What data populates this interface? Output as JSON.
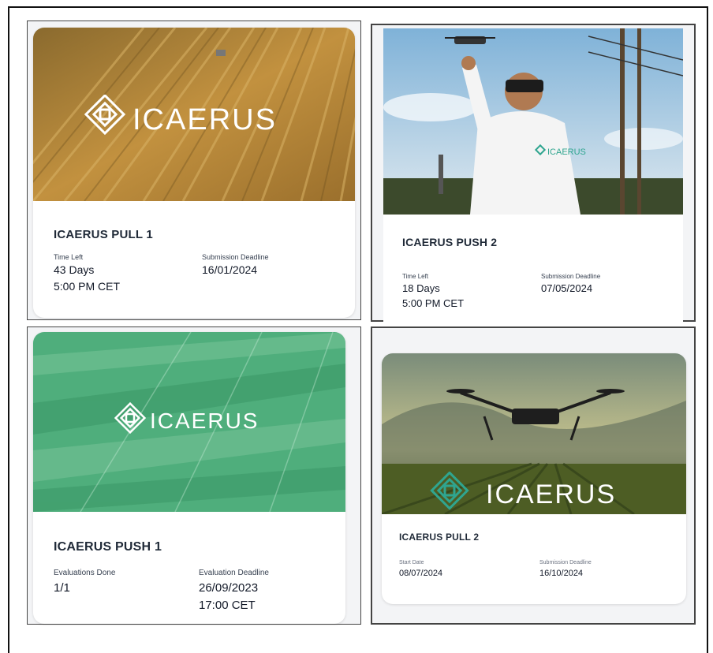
{
  "cards": [
    {
      "title": "ICAERUS PULL 1",
      "left_label": "Time Left",
      "left_value": "43 Days",
      "left_value2": "5:00 PM CET",
      "right_label": "Submission Deadline",
      "right_value": "16/01/2024",
      "logo_text": "ICAERUS"
    },
    {
      "title": "ICAERUS PUSH 2",
      "left_label": "Time Left",
      "left_value": "18 Days",
      "left_value2": "5:00 PM CET",
      "right_label": "Submission Deadline",
      "right_value": "07/05/2024",
      "logo_text": "ICAERUS"
    },
    {
      "title": "ICAERUS PUSH 1",
      "left_label": "Evaluations Done",
      "left_value": "1/1",
      "right_label": "Evaluation Deadline",
      "right_value": "26/09/2023",
      "right_value2": "17:00 CET",
      "logo_text": "ICAERUS"
    },
    {
      "title": "ICAERUS PULL 2",
      "left_label": "Start Date",
      "left_value": "08/07/2024",
      "right_label": "Submission Deadline",
      "right_value": "16/10/2024",
      "logo_text": "ICAERUS"
    }
  ],
  "colors": {
    "wheat": "#b98a3e",
    "green_overlay": "#3fae7e",
    "sky": "#9cc3df",
    "logo_teal": "#2fa58f"
  }
}
